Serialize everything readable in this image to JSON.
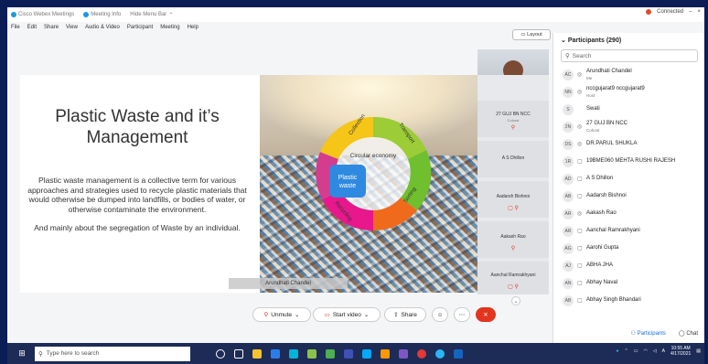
{
  "titlebar": {
    "app": "Cisco Webex Meetings",
    "meeting_info": "Meeting Info",
    "hide_menu": "Hide Menu Bar",
    "connected": "Connected"
  },
  "menu": [
    "File",
    "Edit",
    "Share",
    "View",
    "Audio & Video",
    "Participant",
    "Meeting",
    "Help"
  ],
  "layout_label": "Layout",
  "slide": {
    "title": "Plastic Waste and it’s Management",
    "body1": "Plastic waste management is a collective term for various approaches and strategies used to recycle plastic materials that would otherwise be dumped into landfills, or bodies of water, or otherwise contaminate the environment.",
    "body2": "And mainly about the segregation of Waste by an individual.",
    "cycle": {
      "center": "Circular economy",
      "plastic": "Plastic waste",
      "collection": "Collection",
      "transport": "Transport",
      "sorting": "Sorting",
      "recycling": "Recycling"
    }
  },
  "presenter_label": "Arundhati Chandel",
  "thumbs": [
    {
      "name": "27 GUJ BN NCC",
      "sub": "Cohost"
    },
    {
      "name": "A S Dhillon"
    },
    {
      "name": "Aadarsh Bishnoi"
    },
    {
      "name": "Aakash Rao"
    },
    {
      "name": "Aanchal Ramrakhyani"
    }
  ],
  "participants": {
    "header": "Participants (290)",
    "search_placeholder": "Search",
    "list": [
      {
        "initials": "AC",
        "name": "Arundhati Chandel",
        "sub": "Me"
      },
      {
        "initials": "NN",
        "name": "nccgujarat9 nccgujarat9",
        "sub": "Host"
      },
      {
        "initials": "S",
        "name": "Swati",
        "sub": ""
      },
      {
        "initials": "2N",
        "name": "27 GUJ BN NCC",
        "sub": "Cohost"
      },
      {
        "initials": "DS",
        "name": "DR.PARUL SHUKLA",
        "sub": ""
      },
      {
        "initials": "1R",
        "name": "19BME060 MEHTA RUSHI RAJESH",
        "sub": ""
      },
      {
        "initials": "AD",
        "name": "A S Dhillon",
        "sub": ""
      },
      {
        "initials": "AB",
        "name": "Aadarsh Bishnoi",
        "sub": ""
      },
      {
        "initials": "AR",
        "name": "Aakash Rao",
        "sub": ""
      },
      {
        "initials": "AR",
        "name": "Aanchal Ramrakhyani",
        "sub": ""
      },
      {
        "initials": "AG",
        "name": "Aarohi Gupta",
        "sub": ""
      },
      {
        "initials": "AJ",
        "name": "ABHA JHA",
        "sub": ""
      },
      {
        "initials": "AN",
        "name": "Abhay Naval",
        "sub": ""
      },
      {
        "initials": "AB",
        "name": "Abhay Singh Bhandari",
        "sub": ""
      }
    ],
    "btn_participants": "Participants",
    "btn_chat": "Chat"
  },
  "controls": {
    "unmute": "Unmute",
    "start_video": "Start video",
    "share": "Share"
  },
  "taskbar": {
    "search_placeholder": "Type here to search",
    "time": "10:55 AM",
    "date": "4/17/2021"
  }
}
